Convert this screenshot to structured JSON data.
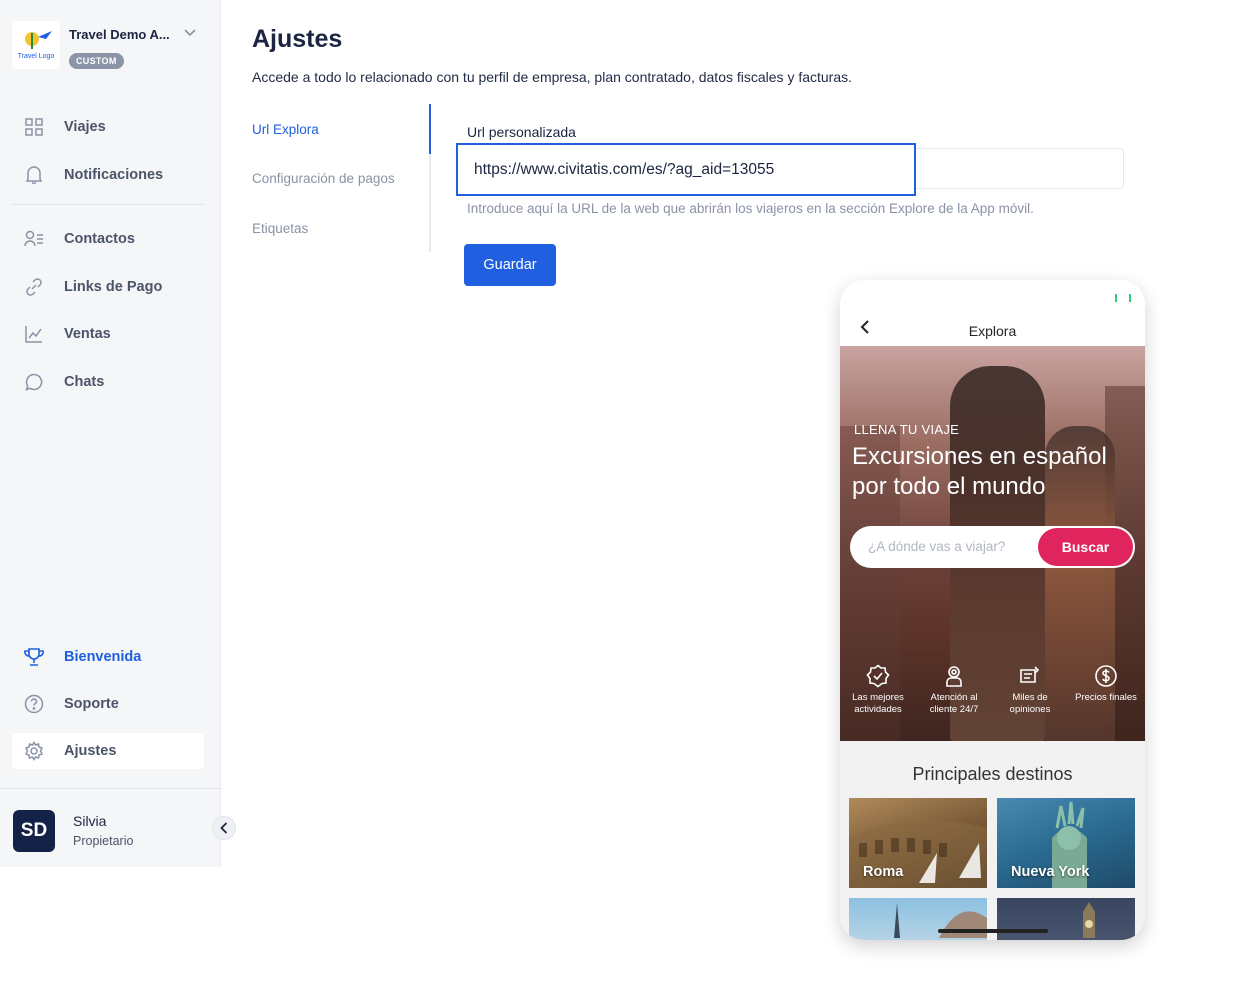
{
  "brand": {
    "name": "Travel Demo A...",
    "badge": "CUSTOM",
    "logo_text": "Travel Logo"
  },
  "sidebar": {
    "items": [
      {
        "label": "Viajes",
        "icon": "grid-icon"
      },
      {
        "label": "Notificaciones",
        "icon": "bell-icon"
      },
      {
        "label": "Contactos",
        "icon": "contacts-icon"
      },
      {
        "label": "Links de Pago",
        "icon": "link-icon"
      },
      {
        "label": "Ventas",
        "icon": "chart-icon"
      },
      {
        "label": "Chats",
        "icon": "chat-bubble-icon"
      }
    ],
    "bottom_items": [
      {
        "label": "Bienvenida",
        "icon": "trophy-icon",
        "active": true
      },
      {
        "label": "Soporte",
        "icon": "help-circle-icon"
      },
      {
        "label": "Ajustes",
        "icon": "gear-icon",
        "selected": true
      }
    ]
  },
  "user": {
    "initials": "SD",
    "name": "Silvia",
    "role": "Propietario"
  },
  "main": {
    "title": "Ajustes",
    "subtitle": "Accede a todo lo relacionado con tu perfil de empresa, plan contratado, datos fiscales y facturas.",
    "subnav": [
      "Url Explora",
      "Configuración de pagos",
      "Etiquetas"
    ],
    "field_label": "Url personalizada",
    "field_value": "https://www.civitatis.com/es/?ag_aid=13055",
    "field_help": "Introduce aquí la URL de la web que abrirán los viajeros en la sección Explore de la App móvil.",
    "save_label": "Guardar"
  },
  "phone": {
    "header": "Explora",
    "hero_kicker": "LLENA TU VIAJE",
    "hero_title": "Excursiones en español por todo el mundo",
    "search_placeholder": "¿A dónde vas a viajar?",
    "search_button": "Buscar",
    "features": [
      {
        "label": "Las mejores actividades",
        "icon": "badge-check-icon"
      },
      {
        "label": "Atención al cliente 24/7",
        "icon": "support-agent-icon"
      },
      {
        "label": "Miles de opiniones",
        "icon": "reviews-icon"
      },
      {
        "label": "Precios finales",
        "icon": "dollar-icon"
      }
    ],
    "destinations_title": "Principales destinos",
    "destinations": [
      "Roma",
      "Nueva York",
      "",
      ""
    ],
    "accent": "#e0245e"
  },
  "colors": {
    "primary": "#1f5fe0",
    "sidebar_bg": "#f5f6f8",
    "dark_navy": "#142247"
  }
}
